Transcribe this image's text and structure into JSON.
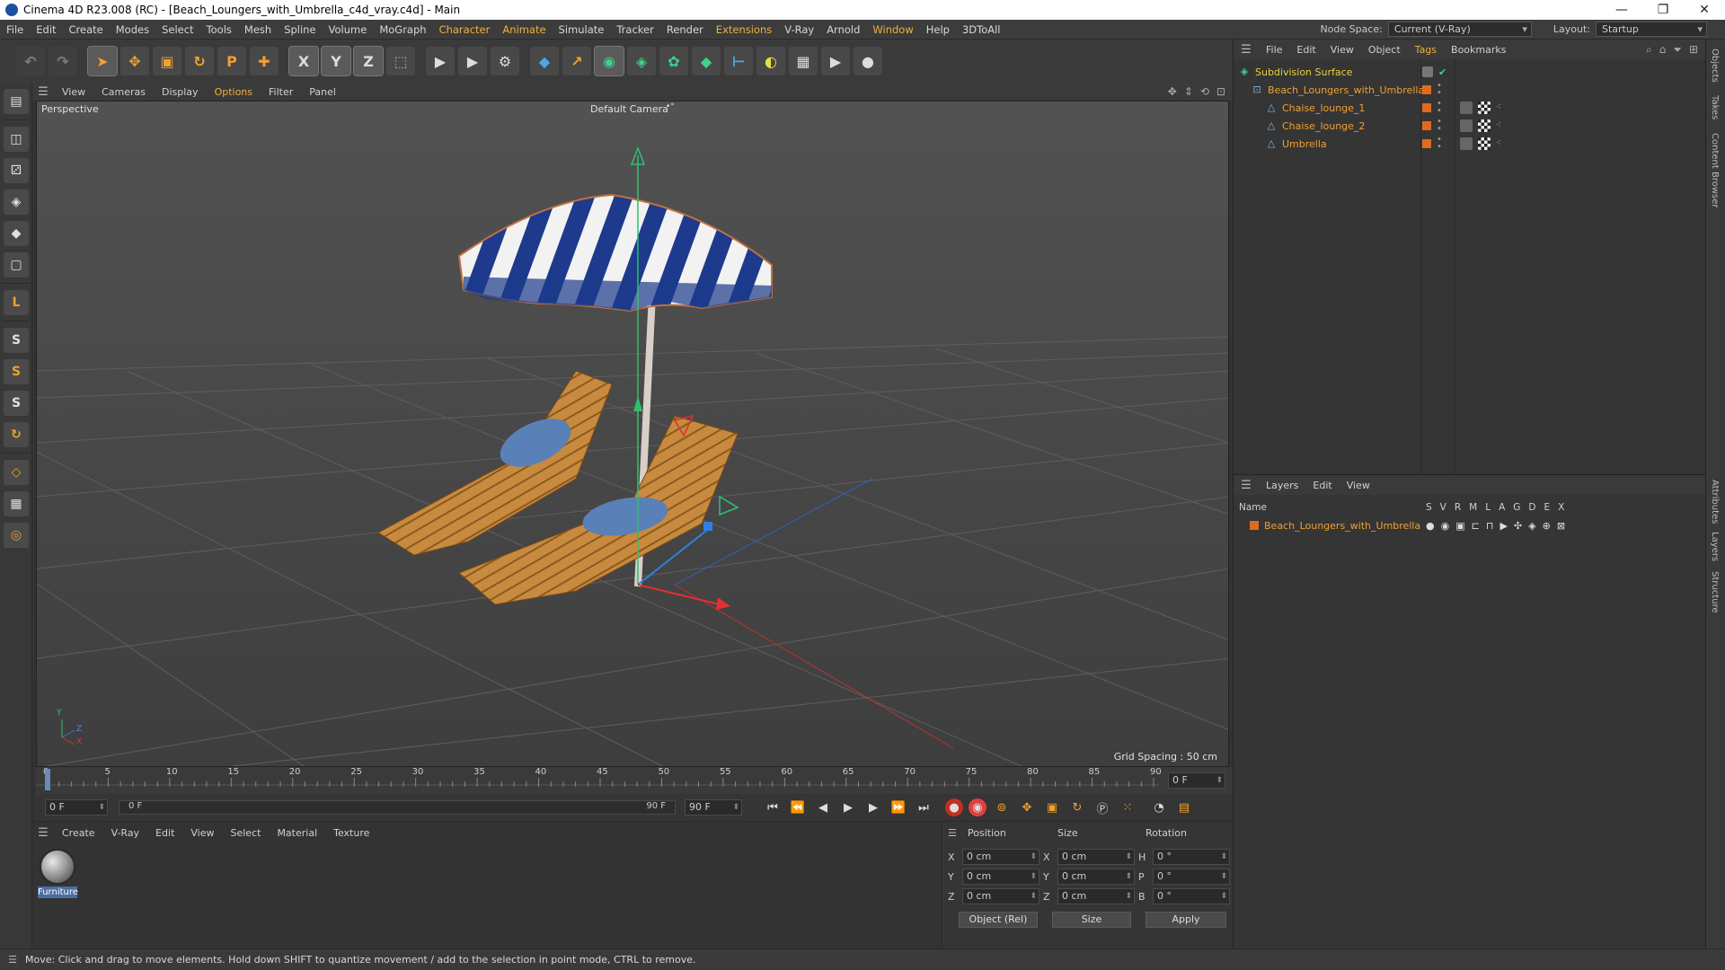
{
  "window": {
    "title": "Cinema 4D R23.008 (RC) - [Beach_Loungers_with_Umbrella_c4d_vray.c4d] - Main",
    "controls": [
      "—",
      "❐",
      "✕"
    ]
  },
  "menubar": {
    "items": [
      "File",
      "Edit",
      "Create",
      "Modes",
      "Select",
      "Tools",
      "Mesh",
      "Spline",
      "Volume",
      "MoGraph",
      "Character",
      "Animate",
      "Simulate",
      "Tracker",
      "Render",
      "Extensions",
      "V-Ray",
      "Arnold",
      "Window",
      "Help",
      "3DToAll"
    ],
    "node_space_label": "Node Space:",
    "node_space_value": "Current (V-Ray)",
    "layout_label": "Layout:",
    "layout_value": "Startup"
  },
  "toolbar": {
    "buttons": [
      "↶",
      "↷",
      "➤",
      "✥",
      "▣",
      "↻",
      "P",
      "✚",
      "X",
      "Y",
      "Z",
      "⬚",
      "▶",
      "▶",
      "⚙",
      "◆",
      "↗",
      "◉",
      "◈",
      "✿",
      "◆",
      "⊢",
      "◐",
      "▦",
      "▶",
      "●"
    ]
  },
  "left_tools": [
    "▤",
    "◫",
    "⚂",
    "◈",
    "◆",
    "▢",
    "L",
    "S",
    "S",
    "S",
    "↻",
    "◇",
    "▦",
    "◎"
  ],
  "viewport": {
    "menu": [
      "View",
      "Cameras",
      "Display",
      "Options",
      "Filter",
      "Panel"
    ],
    "name": "Perspective",
    "camera": "Default Camera",
    "camera_icon": "•°",
    "grid_spacing": "Grid Spacing : 50 cm",
    "axis_y": "Y",
    "axis_z": "Z",
    "axis_x": "X"
  },
  "timeline": {
    "ticks": [
      "0",
      "5",
      "10",
      "15",
      "20",
      "25",
      "30",
      "35",
      "40",
      "45",
      "50",
      "55",
      "60",
      "65",
      "70",
      "75",
      "80",
      "85",
      "90"
    ],
    "current_frame": "0 F"
  },
  "transport": {
    "start": "0 F",
    "range_start": "0 F",
    "range_end": "90 F",
    "end": "90 F"
  },
  "materials": {
    "menu": [
      "Create",
      "V-Ray",
      "Edit",
      "View",
      "Select",
      "Material",
      "Texture"
    ],
    "items": [
      {
        "name": "Furniture"
      }
    ]
  },
  "coordinates": {
    "headers": {
      "position": "Position",
      "size": "Size",
      "rotation": "Rotation"
    },
    "rows": [
      {
        "axis": "X",
        "pos": "0 cm",
        "size_axis": "X",
        "size": "0 cm",
        "rot_axis": "H",
        "rot": "0 °"
      },
      {
        "axis": "Y",
        "pos": "0 cm",
        "size_axis": "Y",
        "size": "0 cm",
        "rot_axis": "P",
        "rot": "0 °"
      },
      {
        "axis": "Z",
        "pos": "0 cm",
        "size_axis": "Z",
        "size": "0 cm",
        "rot_axis": "B",
        "rot": "0 °"
      }
    ],
    "mode": "Object (Rel)",
    "size_mode": "Size",
    "apply": "Apply"
  },
  "status": {
    "message": "Move: Click and drag to move elements. Hold down SHIFT to quantize movement / add to the selection in point mode, CTRL to remove."
  },
  "object_manager": {
    "menu": [
      "File",
      "Edit",
      "View",
      "Object",
      "Tags",
      "Bookmarks"
    ],
    "objects": [
      {
        "name": "Subdivision Surface"
      },
      {
        "name": "Beach_Loungers_with_Umbrella"
      },
      {
        "name": "Chaise_lounge_1"
      },
      {
        "name": "Chaise_lounge_2"
      },
      {
        "name": "Umbrella"
      }
    ]
  },
  "layer_manager": {
    "menu": [
      "Layers",
      "Edit",
      "View"
    ],
    "name_header": "Name",
    "columns": [
      "S",
      "V",
      "R",
      "M",
      "L",
      "A",
      "G",
      "D",
      "E",
      "X"
    ],
    "layers": [
      {
        "name": "Beach_Loungers_with_Umbrella"
      }
    ]
  },
  "side_tabs": [
    "Objects",
    "Takes",
    "Content Browser",
    "Attributes",
    "Layers",
    "Structure"
  ]
}
